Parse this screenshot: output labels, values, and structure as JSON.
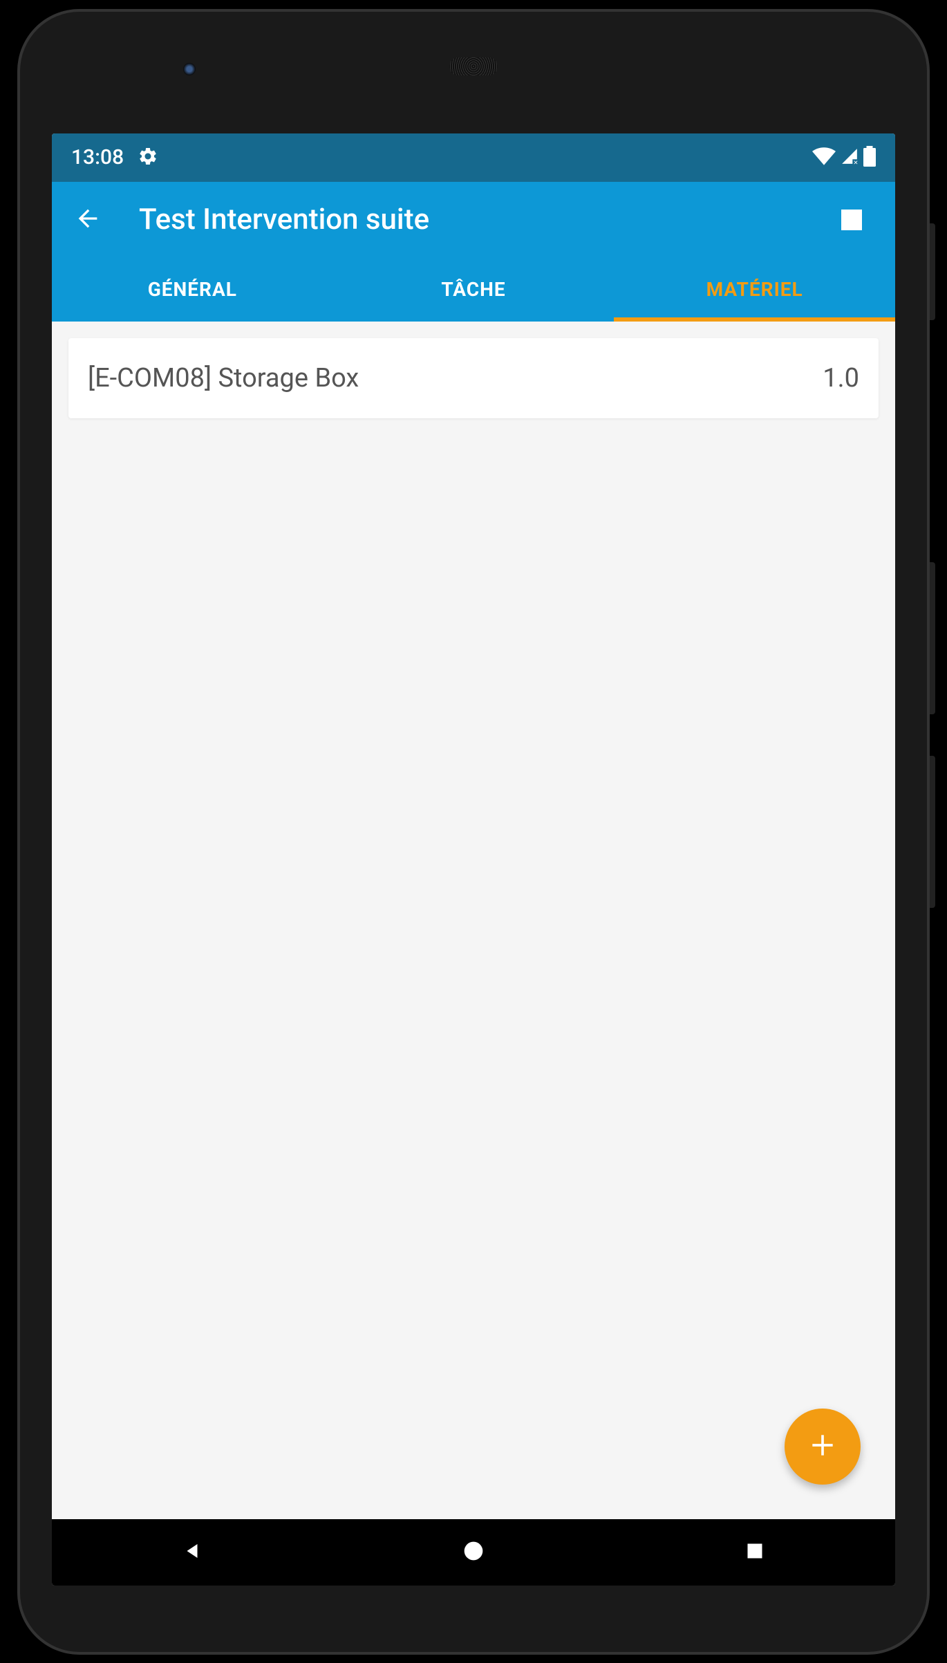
{
  "statusBar": {
    "time": "13:08"
  },
  "appBar": {
    "title": "Test Intervention suite"
  },
  "tabs": [
    {
      "label": "GÉNÉRAL",
      "active": false
    },
    {
      "label": "TÂCHE",
      "active": false
    },
    {
      "label": "MATÉRIEL",
      "active": true
    }
  ],
  "materials": [
    {
      "name": "[E-COM08] Storage Box",
      "quantity": "1.0"
    }
  ],
  "colors": {
    "primary": "#0d98d6",
    "primaryDark": "#16698e",
    "accent": "#f39c12"
  }
}
